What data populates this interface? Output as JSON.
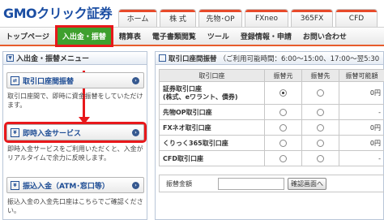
{
  "header": {
    "logo_gmo": "GMO",
    "logo_rest": "クリック証券",
    "tabs": [
      {
        "label": "ホーム",
        "color": "#e84a2a"
      },
      {
        "label": "株 式",
        "color": "#e84a2a"
      },
      {
        "label": "先物･OP",
        "color": "#e84a2a"
      },
      {
        "label": "FXneo",
        "color": "#e84a2a"
      },
      {
        "label": "365FX",
        "color": "#e84a2a"
      },
      {
        "label": "CFD",
        "color": "#e84a2a"
      }
    ]
  },
  "nav": {
    "items": [
      "トップページ",
      "入出金・振替",
      "精算表",
      "電子書類閲覧",
      "ツール",
      "登録情報・申請",
      "お問い合わせ"
    ],
    "active_index": 1,
    "active_color": "#3ea02e",
    "highlight_color": "#e8181b"
  },
  "left_panel": {
    "title": "入出金・振替メニュー",
    "menu": [
      {
        "label": "取引口座間振替",
        "desc": "取引口座間で、即時に資金振替をしていただけます。"
      },
      {
        "label": "即時入金サービス",
        "desc": "即時入金サービスをご利用いただくと、入金がリアルタイムで余力に反映します。"
      },
      {
        "label": "振込入金（ATM･窓口等）",
        "desc": "振込入金の入金先口座はこちらでご確認ください。"
      }
    ]
  },
  "right_panel": {
    "title": "取引口座間振替",
    "hours": "（ご利用可能時間：6:00～15:00、17:00～翌5:30",
    "table": {
      "headers": [
        "取引口座",
        "振替元",
        "振替先",
        "振替可能額"
      ],
      "rows": [
        {
          "name": "証券取引口座\n(株式、eワラント、債券)",
          "from": true,
          "to": false,
          "amount": "0円"
        },
        {
          "name": "先物OP取引口座",
          "from": false,
          "to": false,
          "amount": "-"
        },
        {
          "name": "FXネオ取引口座",
          "from": false,
          "to": false,
          "amount": "0円"
        },
        {
          "name": "くりっく365取引口座",
          "from": false,
          "to": false,
          "amount": "0円"
        },
        {
          "name": "CFD取引口座",
          "from": false,
          "to": false,
          "amount": "-"
        }
      ]
    },
    "amount_label": "振替金額",
    "confirm_button": "確認画面へ"
  }
}
